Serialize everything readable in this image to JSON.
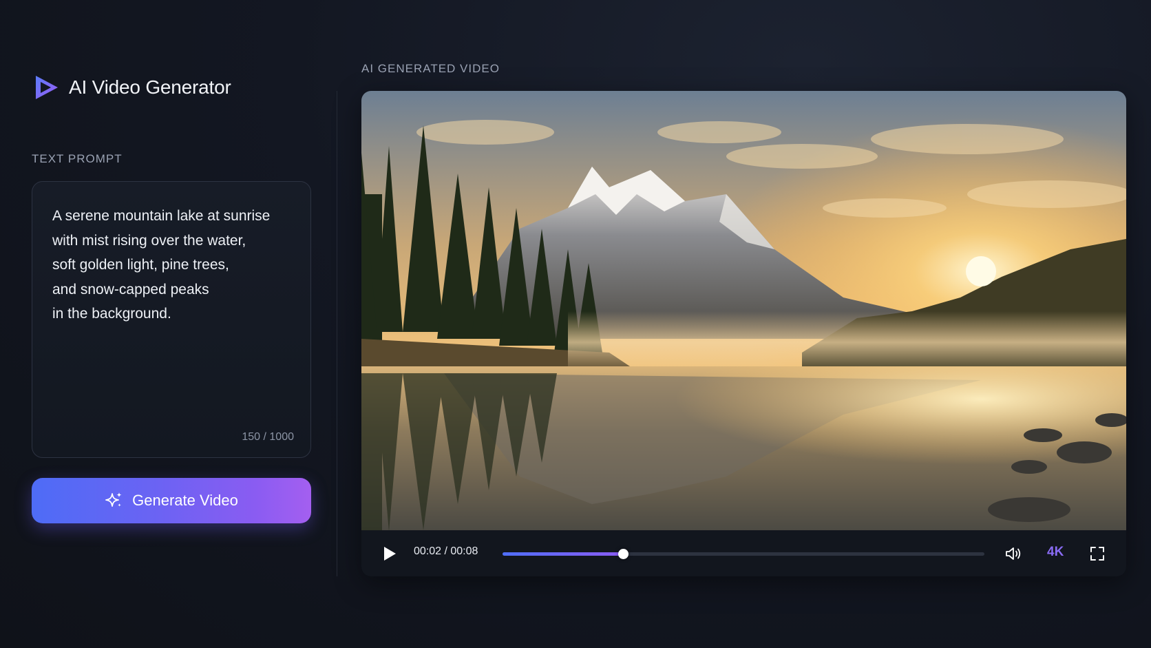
{
  "app": {
    "title": "AI Video Generator"
  },
  "prompt": {
    "label": "TEXT PROMPT",
    "lines": [
      "A serene mountain lake at sunrise",
      "with mist rising over the water,",
      "soft golden light, pine trees,",
      "and snow-capped peaks",
      "in the background."
    ],
    "char_count": "150 / 1000"
  },
  "generate": {
    "label": "Generate Video",
    "icon": "sparkles-icon"
  },
  "video": {
    "label": "AI GENERATED VIDEO",
    "time": "00:02 / 00:08",
    "progress": 0.25,
    "quality": "4K",
    "icons": {
      "play": "play-icon",
      "volume": "volume-icon",
      "fullscreen": "fullscreen-icon"
    }
  },
  "colors": {
    "accent_start": "#4e6cf6",
    "accent_end": "#a45ff0",
    "quality": "#8a6cf5",
    "background": "#131722"
  }
}
